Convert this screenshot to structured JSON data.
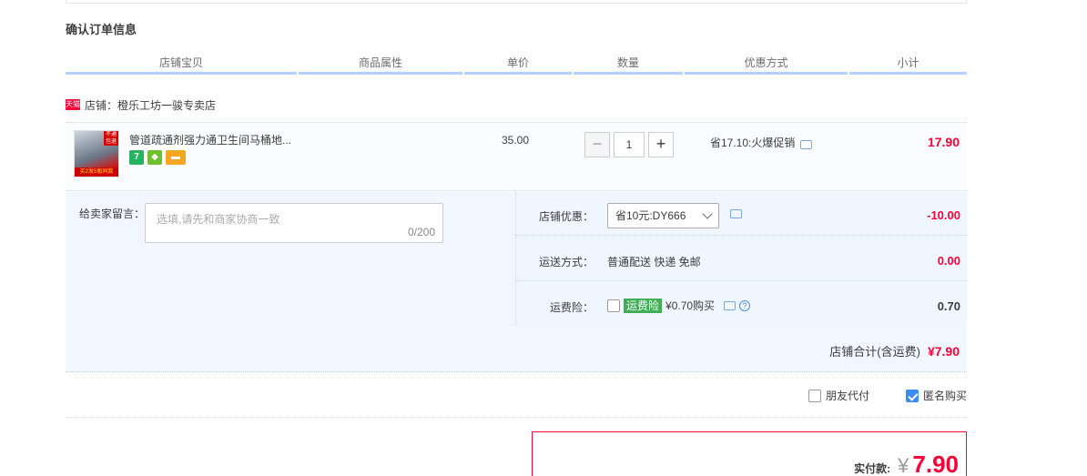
{
  "section_title": "确认订单信息",
  "columns": [
    "店铺宝贝",
    "商品属性",
    "单价",
    "数量",
    "优惠方式",
    "小计"
  ],
  "shop": {
    "badge": "天猫",
    "label": "店铺：橙乐工坊一骏专卖店"
  },
  "item": {
    "thumb_badge": "不通包退",
    "thumb_strip": "买2发5瓶同款",
    "title": "管道疏通剂强力通卫生间马桶地...",
    "service_icons": [
      "seven-day-return-icon",
      "insurance-icon",
      "card-payment-icon"
    ],
    "service_seven": "7",
    "unit_price": "35.00",
    "qty_minus": "−",
    "qty_value": "1",
    "qty_plus": "+",
    "promo": "省17.10:火爆促销",
    "subtotal": "17.90"
  },
  "message": {
    "label": "给卖家留言：",
    "placeholder": "选填,请先和商家协商一致",
    "count": "0/200"
  },
  "shop_discount": {
    "label": "店铺优惠：",
    "selected": "省10元:DY666",
    "amount": "-10.00"
  },
  "shipping": {
    "label": "运送方式：",
    "method": "普通配送 快递 免邮",
    "amount": "0.00"
  },
  "insurance": {
    "label": "运费险：",
    "tag": "运费险",
    "price": "¥0.70购买",
    "help": "?",
    "amount": "0.70"
  },
  "shop_total": {
    "label": "店铺合计(含运费)",
    "amount": "¥7.90"
  },
  "options": {
    "friend_pay": "朋友代付",
    "anonymous": "匿名购买",
    "anonymous_checked": true,
    "friend_checked": false
  },
  "payment": {
    "label": "实付款:",
    "currency": "¥",
    "amount": "7.90"
  },
  "colors": {
    "accent_red": "#ff0036",
    "header_underline": "#b2d1ff",
    "panel_bg": "#f2f7ff"
  }
}
